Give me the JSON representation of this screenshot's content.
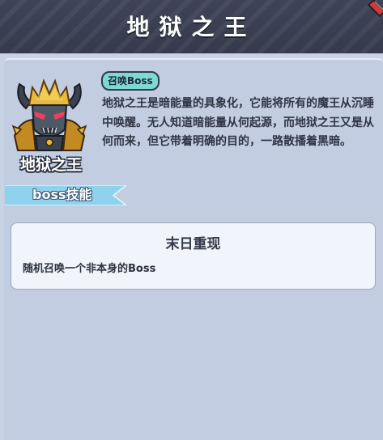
{
  "header": {
    "title": "地狱之王"
  },
  "boss": {
    "name": "地狱之王",
    "tag": "召唤Boss",
    "description": "地狱之王是暗能量的具象化，它能将所有的魔王从沉睡中唤醒。无人知道暗能量从何起源，而地狱之王又是从何而来，但它带着明确的目的，一路散播着黑暗。"
  },
  "skills_section": {
    "label": "boss技能"
  },
  "skill": {
    "name": "末日重现",
    "description": "随机召唤一个非本身的Boss"
  },
  "colors": {
    "header_bg": "#3e4457",
    "panel_bg": "#c2cde1",
    "tag_bg": "#7ed9d5",
    "ribbon_bg": "#8fd2ee"
  },
  "icons": [
    "close-icon",
    "boss-avatar-icon"
  ]
}
